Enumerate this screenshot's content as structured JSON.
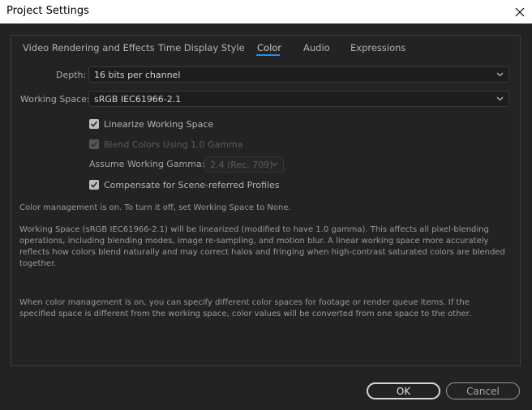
{
  "window": {
    "title": "Project Settings",
    "close_icon": "close-icon"
  },
  "tabs": [
    {
      "label": "Video Rendering and Effects",
      "active": false
    },
    {
      "label": "Time Display Style",
      "active": false
    },
    {
      "label": "Color",
      "active": true
    },
    {
      "label": "Audio",
      "active": false
    },
    {
      "label": "Expressions",
      "active": false
    }
  ],
  "depth": {
    "label": "Depth:",
    "value": "16 bits per channel"
  },
  "working_space": {
    "label": "Working Space:",
    "value": "sRGB IEC61966-2.1"
  },
  "options": {
    "linearize": {
      "label": "Linearize Working Space",
      "checked": true,
      "enabled": true
    },
    "blend": {
      "label": "Blend Colors Using 1.0 Gamma",
      "checked": true,
      "enabled": false
    },
    "gamma_label": "Assume Working Gamma:",
    "gamma_value": "2.4 (Rec. 709)",
    "compensate": {
      "label": "Compensate for Scene-referred Profiles",
      "checked": true,
      "enabled": true
    }
  },
  "info": {
    "status": "Color management is on. To turn it off, set Working Space to None.",
    "linear": "Working Space (sRGB IEC61966-2.1) will be linearized (modified to have 1.0 gamma). This affects all pixel-blending operations, including blending modes, image re-sampling, and motion blur. A linear working space more accurately reflects how colors blend naturally and may correct halos and fringing when high-contrast saturated colors are blended together.",
    "footage": "When color management is on, you can specify different color spaces for footage or render queue items. If the specified space is different from the working space, color values will be converted from one space to the other."
  },
  "buttons": {
    "ok": "OK",
    "cancel": "Cancel"
  },
  "colors": {
    "accent": "#2d8ceb",
    "background": "#232323"
  }
}
